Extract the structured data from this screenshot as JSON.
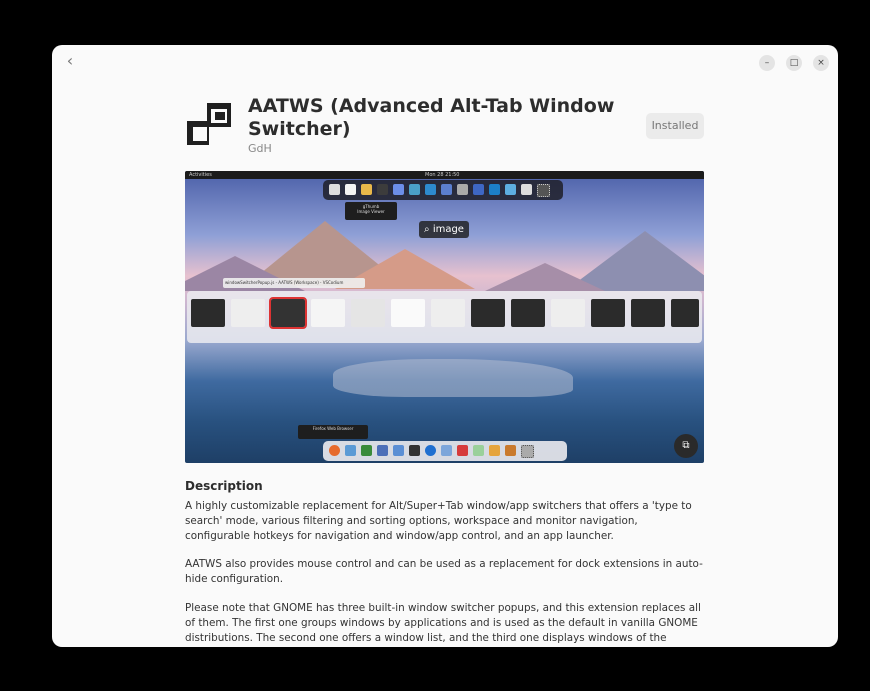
{
  "window": {
    "back_icon": "chevron-left-icon",
    "controls": [
      {
        "name": "minimize",
        "glyph": "–"
      },
      {
        "name": "maximize",
        "glyph": "□"
      },
      {
        "name": "close",
        "glyph": "×"
      }
    ]
  },
  "app": {
    "title": "AATWS (Advanced Alt-Tab Window Switcher)",
    "developer": "GdH",
    "install_state": "Installed"
  },
  "screenshot": {
    "overlay_label": "image",
    "overlay_icon": "search-icon",
    "gallery_icon": "gallery-icon",
    "topbar_left": "Activities",
    "topbar_clock": "Mon 28 21:50",
    "switcher_title": "windowSwitcherPopup.js - AATWS (Workspace) - VSCodium",
    "top_tooltip": "gThumb",
    "top_tooltip_sub": "Image Viewer",
    "bottom_tooltip": "Firefox Web Browser"
  },
  "description": {
    "heading": "Description",
    "paragraphs": [
      "A highly customizable replacement for Alt/Super+Tab window/app switchers that offers a 'type to search' mode, various filtering and sorting options, workspace and monitor navigation, configurable hotkeys for navigation and window/app control, and an app launcher.",
      "AATWS also provides mouse control  and can be used as a replacement for dock extensions in auto-hide configuration.",
      "Please note that GNOME has three built-in window switcher popups, and this extension replaces all of them. The first one groups windows by applications and is used as the default in vanilla GNOME distributions. The second one offers a window list, and the third one displays windows of the currently focused application. You"
    ]
  },
  "colors": {
    "window_bg": "#fafafa",
    "title": "#2d2d2d",
    "muted": "#888888",
    "button_bg": "#ebebeb"
  }
}
